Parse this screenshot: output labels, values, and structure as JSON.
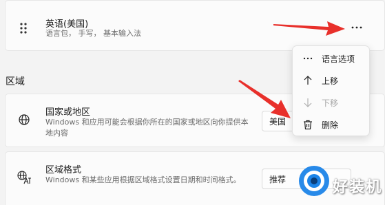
{
  "language_card": {
    "title": "英语(美国)",
    "description": "语言包， 手写， 基本输入法"
  },
  "region_section": {
    "title": "区域"
  },
  "country_card": {
    "title": "国家或地区",
    "description": "Windows 和应用可能会根据你所在的国家或地区向你提供本地内容",
    "selected_value": "美国"
  },
  "format_card": {
    "title": "区域格式",
    "description": "Windows 和某些应用根据区域格式设置日期和时间格式。",
    "selected_value": "推荐"
  },
  "context_menu": {
    "items": [
      {
        "label": "语言选项",
        "icon": "more-icon",
        "enabled": true
      },
      {
        "label": "上移",
        "icon": "arrow-up-icon",
        "enabled": true
      },
      {
        "label": "下移",
        "icon": "arrow-down-icon",
        "enabled": false
      },
      {
        "label": "删除",
        "icon": "trash-icon",
        "enabled": true
      }
    ]
  },
  "watermark": {
    "text": "好装机"
  },
  "colors": {
    "annotation_arrow": "#e8302b",
    "watermark_blue": "#1c84e8"
  }
}
